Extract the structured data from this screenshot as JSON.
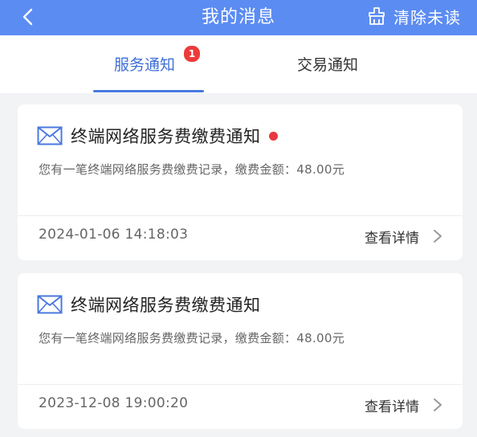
{
  "header": {
    "title": "我的消息",
    "clear_label": "清除未读"
  },
  "tabs": [
    {
      "label": "服务通知",
      "badge": "1",
      "active": true
    },
    {
      "label": "交易通知",
      "active": false
    }
  ],
  "messages": [
    {
      "title": "终端网络服务费缴费通知",
      "unread": true,
      "description": "您有一笔终端网络服务费缴费记录，缴费金额：48.00元",
      "time": "2024-01-06 14:18:03",
      "action_label": "查看详情"
    },
    {
      "title": "终端网络服务费缴费通知",
      "unread": false,
      "description": "您有一笔终端网络服务费缴费记录，缴费金额：48.00元",
      "time": "2023-12-08 19:00:20",
      "action_label": "查看详情"
    }
  ],
  "colors": {
    "header_bg": "#5b8cf2",
    "accent": "#3f6fd8",
    "badge": "#ec3b3b",
    "unread_dot": "#e8383d"
  }
}
